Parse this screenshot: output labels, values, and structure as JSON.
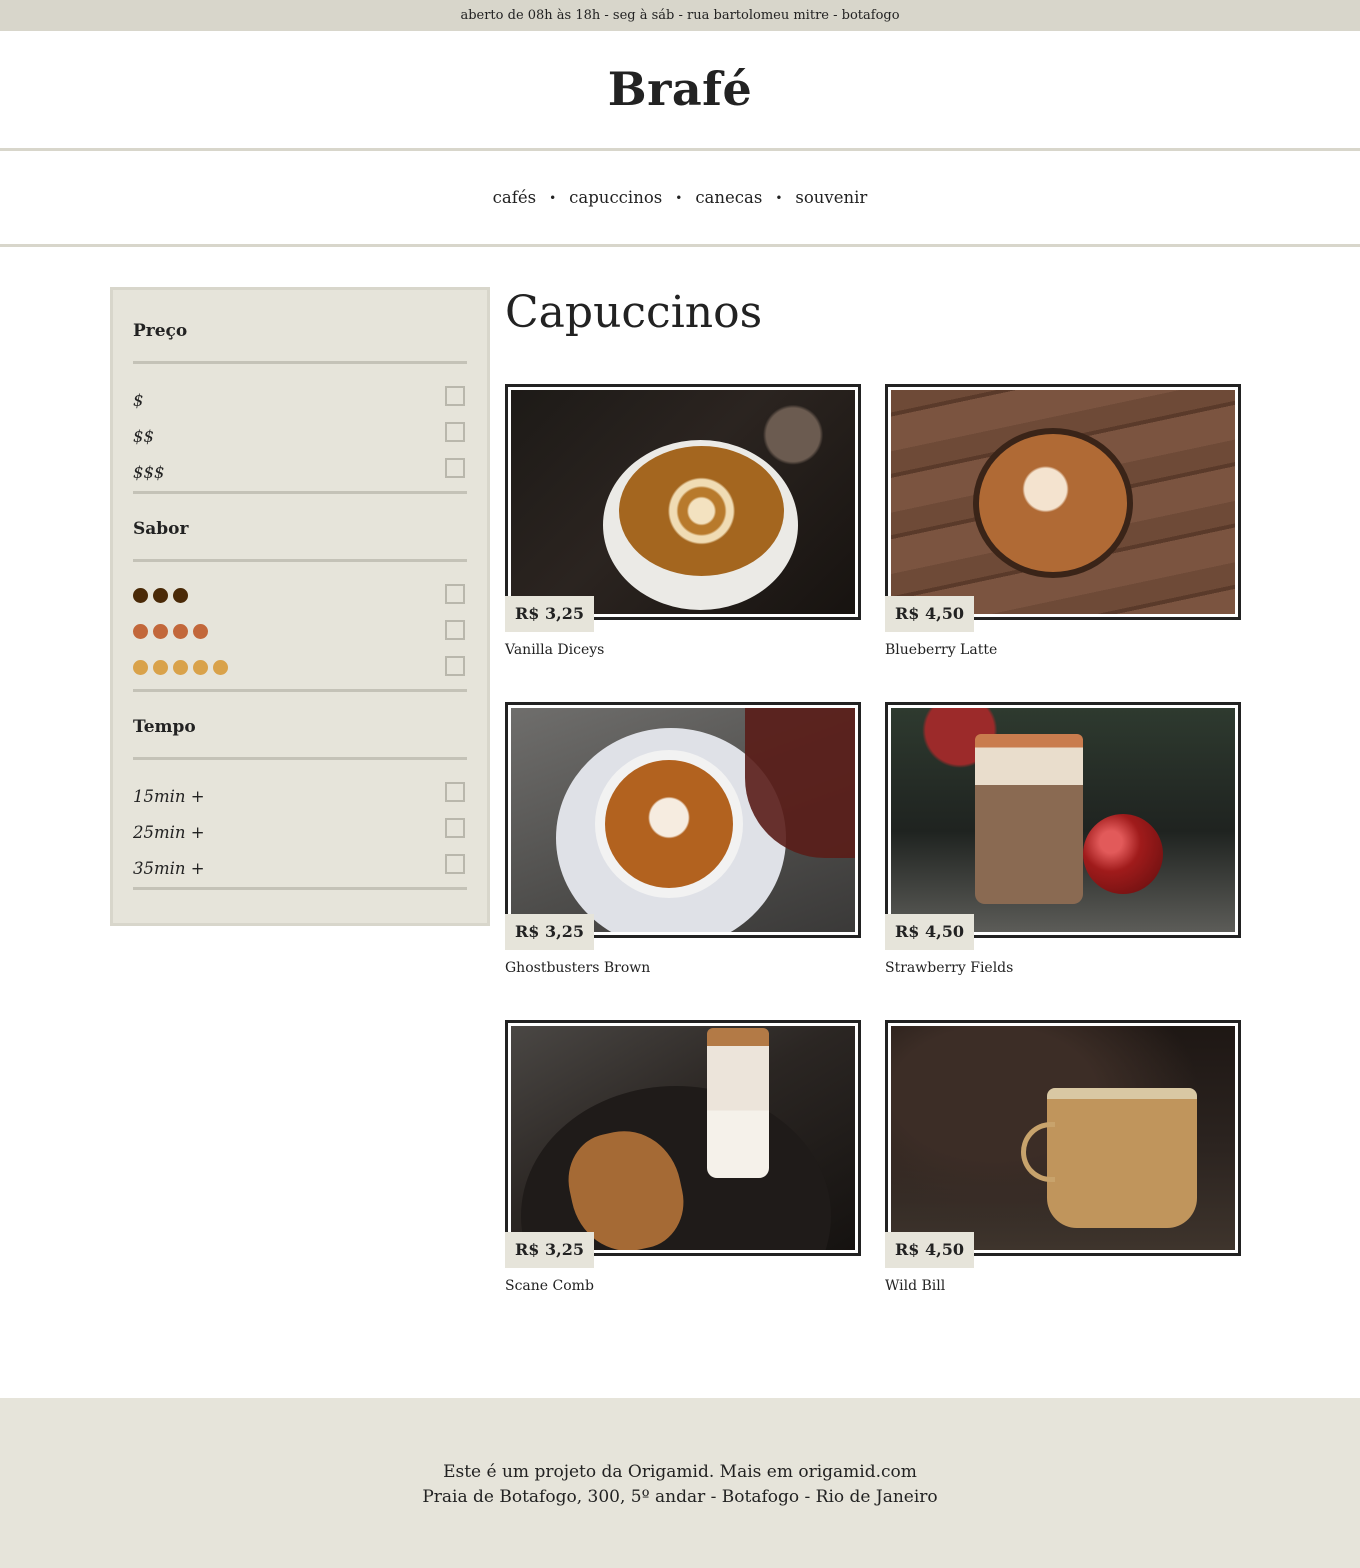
{
  "topbar": {
    "text": "aberto de 08h às 18h - seg à sáb - rua bartolomeu mitre - botafogo"
  },
  "header": {
    "brand": "Brafé"
  },
  "nav": {
    "items": [
      {
        "label": "cafés"
      },
      {
        "label": "capuccinos"
      },
      {
        "label": "canecas"
      },
      {
        "label": "souvenir"
      }
    ],
    "separator": "•"
  },
  "filters": {
    "price": {
      "title": "Preço",
      "options": [
        "$",
        "$$",
        "$$$"
      ]
    },
    "flavor": {
      "title": "Sabor",
      "options": [
        {
          "dots": 3,
          "color": "#4a2a08"
        },
        {
          "dots": 4,
          "color": "#c2673a"
        },
        {
          "dots": 5,
          "color": "#d9a24a"
        }
      ]
    },
    "time": {
      "title": "Tempo",
      "options": [
        "15min +",
        "25min +",
        "35min +"
      ]
    }
  },
  "page": {
    "title": "Capuccinos"
  },
  "products": [
    {
      "name": "Vanilla Diceys",
      "price": "R$ 3,25"
    },
    {
      "name": "Blueberry Latte",
      "price": "R$ 4,50"
    },
    {
      "name": "Ghostbusters Brown",
      "price": "R$ 3,25"
    },
    {
      "name": "Strawberry Fields",
      "price": "R$ 4,50"
    },
    {
      "name": "Scane Comb",
      "price": "R$ 3,25"
    },
    {
      "name": "Wild Bill",
      "price": "R$ 4,50"
    }
  ],
  "footer": {
    "line1": "Este é um projeto da Origamid. Mais em origamid.com",
    "line2": "Praia de Botafogo, 300, 5º andar - Botafogo - Rio de Janeiro"
  },
  "colors": {
    "beige": "#e6e4da",
    "bar": "#d8d6cb",
    "text": "#222222"
  }
}
